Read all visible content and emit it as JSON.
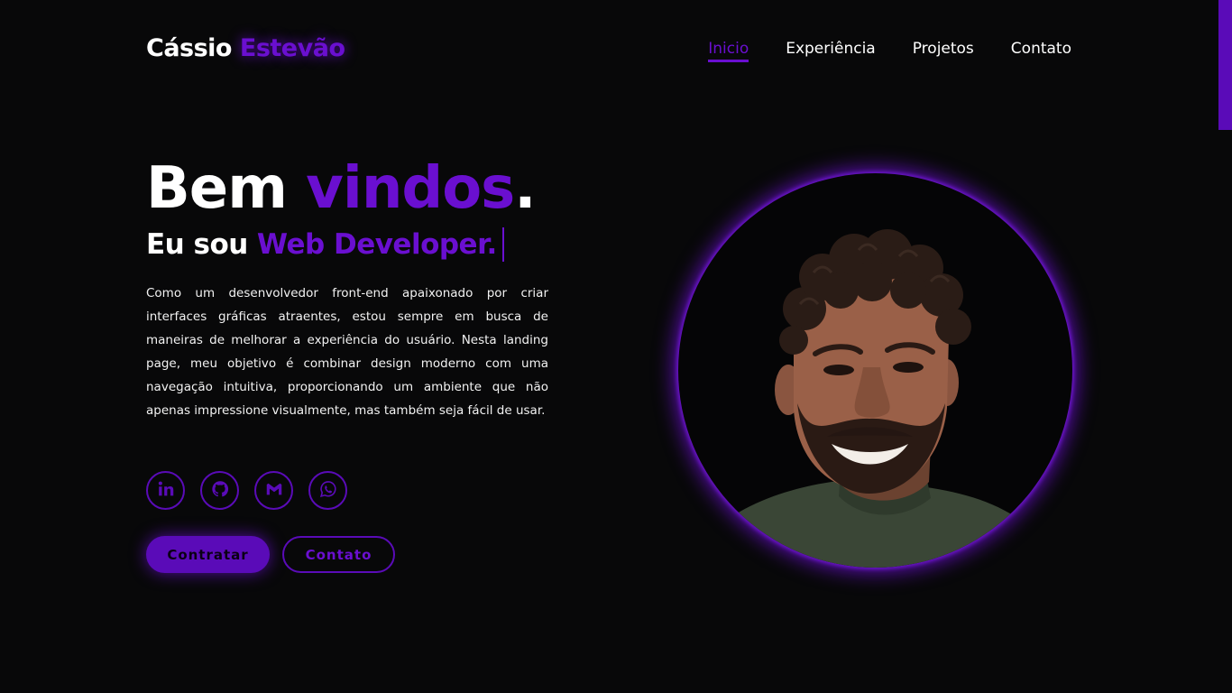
{
  "header": {
    "logo_first": "Cássio",
    "logo_accent": "Estevão",
    "nav": [
      {
        "label": "Inicio",
        "active": true
      },
      {
        "label": "Experiência"
      },
      {
        "label": "Projetos"
      },
      {
        "label": "Contato"
      }
    ]
  },
  "hero": {
    "title_main": "Bem",
    "title_accent": "vindos",
    "title_dot": ".",
    "sub_main": "Eu sou",
    "sub_accent": "Web Developer.",
    "description": "Como um desenvolvedor front-end apaixonado por criar interfaces gráficas atraentes, estou sempre em busca de maneiras de melhorar a experiência do usuário. Nesta landing page, meu objetivo é combinar design moderno com uma navegação intuitiva, proporcionando um ambiente que não apenas impressione visualmente, mas também seja fácil de usar."
  },
  "social": [
    {
      "icon": "linkedin-icon"
    },
    {
      "icon": "github-icon"
    },
    {
      "icon": "gmail-icon"
    },
    {
      "icon": "whatsapp-icon"
    }
  ],
  "actions": {
    "hire_label": "Contratar",
    "contact_label": "Contato"
  },
  "colors": {
    "accent": "#6a0fd0",
    "accent_dark": "#5a0bb8",
    "background": "#080809",
    "text": "#ffffff"
  }
}
